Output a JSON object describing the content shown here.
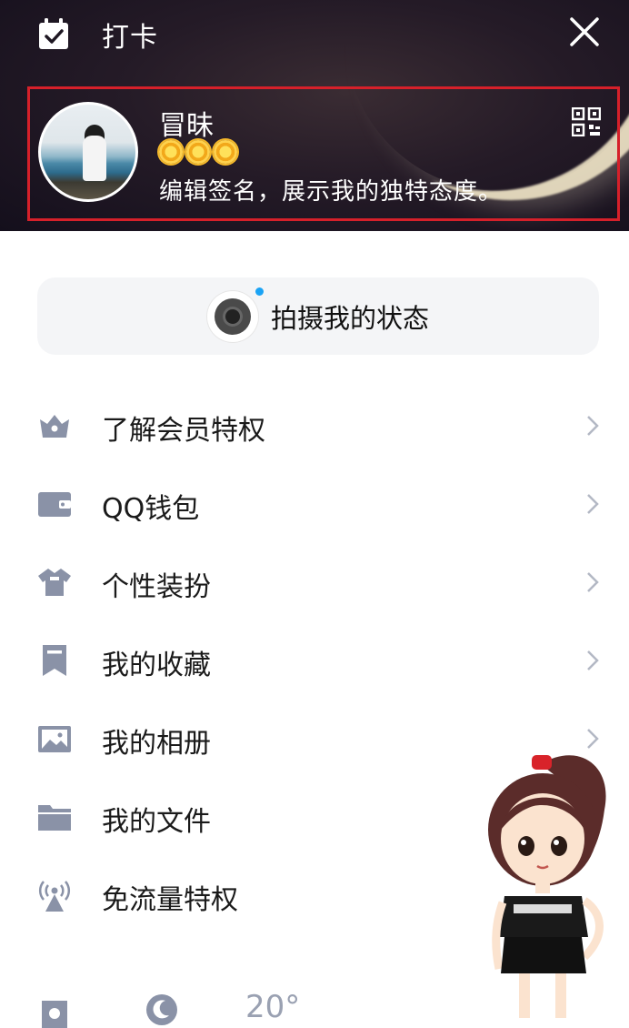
{
  "header": {
    "checkin_label": "打卡",
    "profile": {
      "name": "冒昧",
      "signature": "编辑签名，展示我的独特态度。",
      "level_icons": [
        "sun-icon",
        "sun-icon",
        "sun-icon"
      ]
    }
  },
  "status_button": {
    "label": "拍摄我的状态"
  },
  "menu": {
    "items": [
      {
        "label": "了解会员特权",
        "icon": "crown-icon"
      },
      {
        "label": "QQ钱包",
        "icon": "wallet-icon"
      },
      {
        "label": "个性装扮",
        "icon": "shirt-icon"
      },
      {
        "label": "我的收藏",
        "icon": "bookmark-icon"
      },
      {
        "label": "我的相册",
        "icon": "photo-icon"
      },
      {
        "label": "我的文件",
        "icon": "folder-icon"
      },
      {
        "label": "免流量特权",
        "icon": "signal-tower-icon"
      }
    ]
  },
  "bottom": {
    "temperature": "20°"
  },
  "colors": {
    "accent": "#1aa3f5",
    "highlight_border": "#d6202a",
    "icon_gray": "#8a92a7"
  }
}
